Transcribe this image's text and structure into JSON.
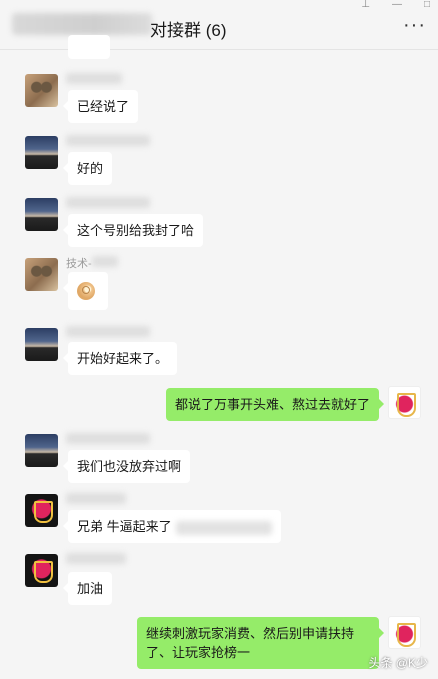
{
  "header": {
    "title": "对接群 (6)",
    "more_icon": "more-icon",
    "window_controls": [
      "pin-icon",
      "minimize-icon",
      "maximize-icon"
    ]
  },
  "messages": [
    {
      "side": "left",
      "avatar": "cat",
      "sender": "",
      "text": "已经说了"
    },
    {
      "side": "left",
      "avatar": "scene",
      "sender": "",
      "text": "好的"
    },
    {
      "side": "left",
      "avatar": "scene",
      "sender": "",
      "text": "这个号别给我封了哈"
    },
    {
      "side": "left",
      "avatar": "cat",
      "sender": "技术-",
      "text": "",
      "icon": "ok-hand-emoji-icon"
    },
    {
      "side": "left",
      "avatar": "scene",
      "sender": "",
      "text": "开始好起来了。"
    },
    {
      "side": "right",
      "avatar": "me",
      "text": "都说了万事开头难、熬过去就好了"
    },
    {
      "side": "left",
      "avatar": "scene",
      "sender": "",
      "text": "我们也没放弃过啊"
    },
    {
      "side": "left",
      "avatar": "logo",
      "sender": "",
      "text": "兄弟 牛逼起来了"
    },
    {
      "side": "left",
      "avatar": "logo",
      "sender": "",
      "text": "加油"
    },
    {
      "side": "right",
      "avatar": "me",
      "text": "继续刺激玩家消费、然后别申请扶持了、让玩家抢榜一"
    }
  ],
  "watermark": "头条 @K少"
}
